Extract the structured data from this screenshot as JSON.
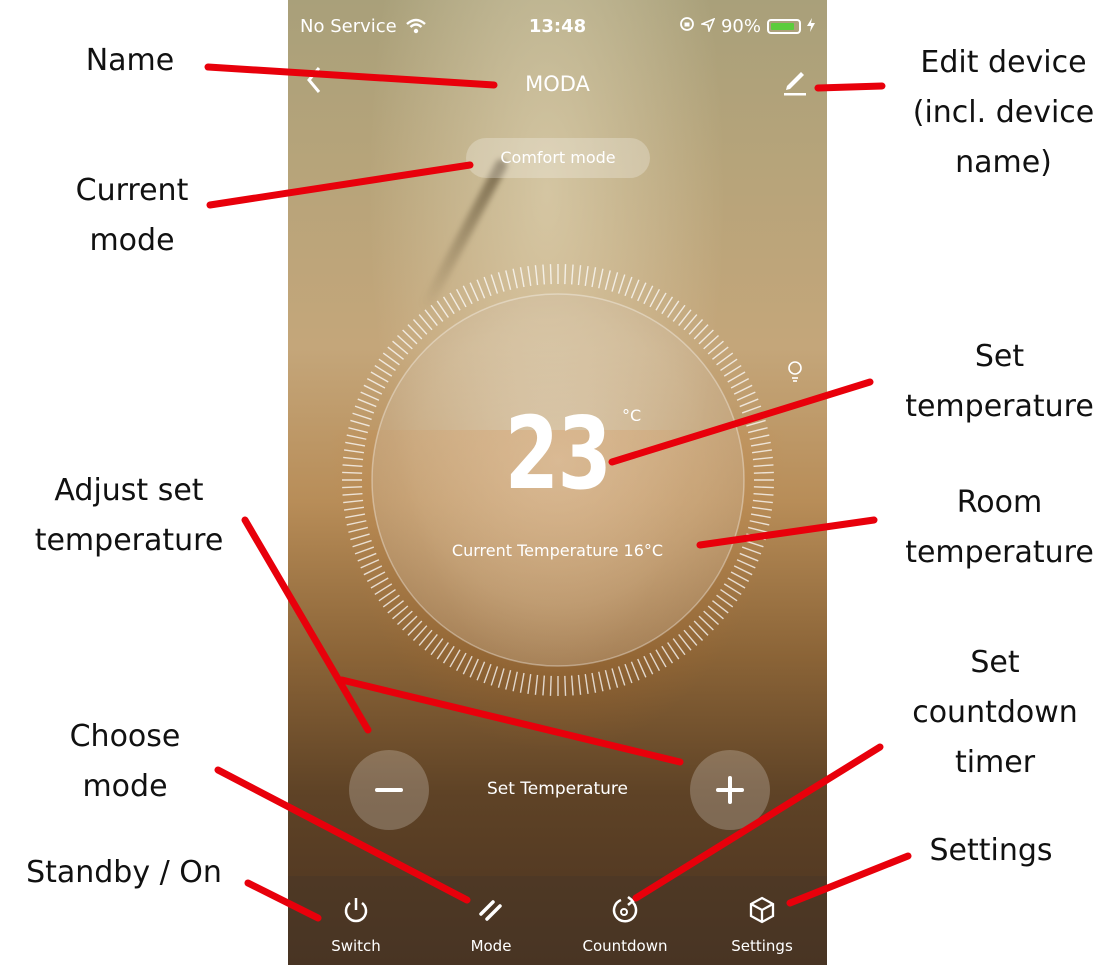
{
  "status_bar": {
    "carrier": "No Service",
    "time": "13:48",
    "battery_pct": "90%",
    "battery_level": 0.9,
    "accent": "#5ccc3c"
  },
  "header": {
    "title": "MODA",
    "back_icon": "chevron-left-icon",
    "edit_icon": "pencil-icon"
  },
  "mode_badge": "Comfort mode",
  "thermostat": {
    "set_temperature": "23",
    "unit": "°C",
    "room_temperature_label": "Current Temperature 16°C"
  },
  "controls": {
    "minus_icon": "minus-icon",
    "plus_icon": "plus-icon",
    "label": "Set Temperature"
  },
  "tabbar": {
    "items": [
      {
        "label": "Switch",
        "icon": "power-icon"
      },
      {
        "label": "Mode",
        "icon": "mode-icon"
      },
      {
        "label": "Countdown",
        "icon": "countdown-icon"
      },
      {
        "label": "Settings",
        "icon": "settings-cube-icon"
      }
    ]
  },
  "annotations": {
    "name": "Name",
    "current_mode_1": "Current",
    "current_mode_2": "mode",
    "edit_1": "Edit device",
    "edit_2": "(incl. device",
    "edit_3": "name)",
    "set_temp_1": "Set",
    "set_temp_2": "temperature",
    "adjust_1": "Adjust set",
    "adjust_2": "temperature",
    "room_1": "Room",
    "room_2": "temperature",
    "choose_1": "Choose",
    "choose_2": "mode",
    "countdown_1": "Set",
    "countdown_2": "countdown",
    "countdown_3": "timer",
    "standby": "Standby / On",
    "settings": "Settings",
    "line_color": "#e8000b"
  }
}
